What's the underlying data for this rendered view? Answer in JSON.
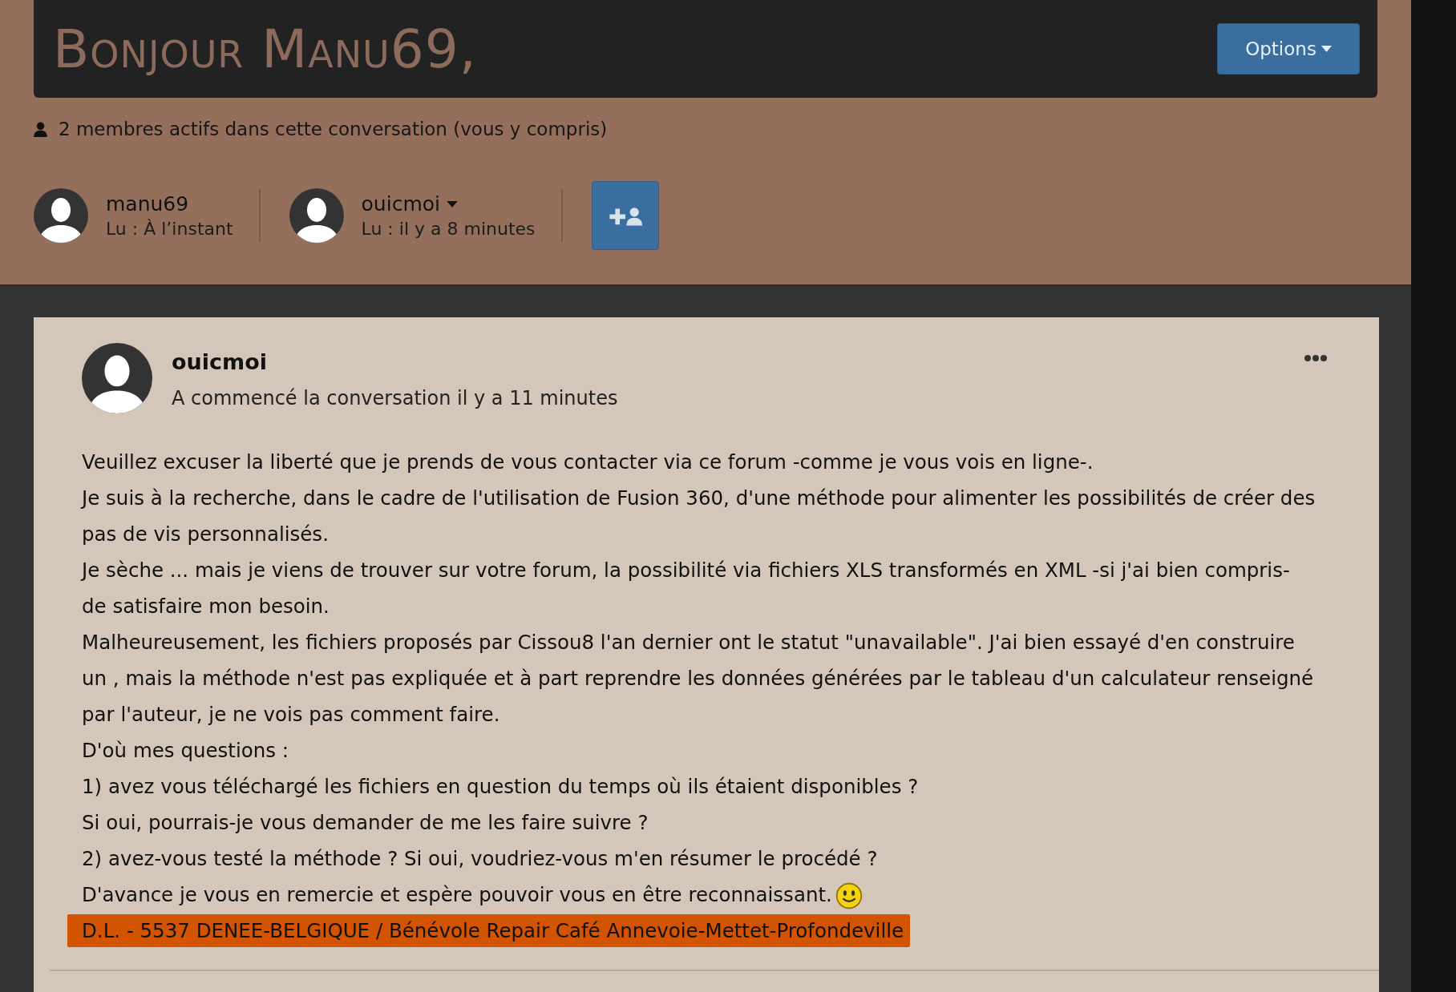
{
  "header": {
    "title": "Bonjour Manu69,",
    "options_button": "Options"
  },
  "members_summary": "2 membres actifs dans cette conversation (vous y compris)",
  "participants": [
    {
      "name": "manu69",
      "read": "Lu : À l’instant",
      "menu": false
    },
    {
      "name": "ouicmoi",
      "read": "Lu : il y a 8 minutes",
      "menu": true
    }
  ],
  "post": {
    "author": "ouicmoi",
    "meta": "A commencé la conversation il y a 11 minutes",
    "paragraphs": [
      {
        "text": "Veuillez excuser la liberté que je prends de vous contacter via ce forum -comme je vous vois en ligne-.",
        "smiley": false
      },
      {
        "text": "Je suis à la recherche, dans le cadre de l'utilisation de Fusion 360, d'une méthode pour alimenter les possibilités de créer des pas de vis personnalisés.",
        "smiley": false
      },
      {
        "text": "Je sèche ... mais je viens de trouver sur votre forum, la possibilité via fichiers XLS transformés en XML -si j'ai bien compris- de satisfaire mon besoin.",
        "smiley": false
      },
      {
        "text": "Malheureusement, les fichiers proposés par Cissou8 l'an dernier ont le statut \"unavailable\". J'ai bien essayé d'en construire un , mais la méthode n'est pas expliquée et à part reprendre les données générées par le tableau d'un calculateur renseigné par l'auteur, je ne vois pas comment faire.",
        "smiley": false
      },
      {
        "text": "D'où mes questions :",
        "smiley": false
      },
      {
        "text": "1) avez vous téléchargé les fichiers en question du temps où ils étaient disponibles ?",
        "smiley": false
      },
      {
        "text": "Si oui, pourrais-je vous demander de me les faire suivre ?",
        "smiley": false
      },
      {
        "text": "2) avez-vous testé la méthode ? Si oui, voudriez-vous m'en résumer le procédé ?",
        "smiley": false
      },
      {
        "text": "D'avance je vous en remercie et espère pouvoir vous en être reconnaissant.",
        "smiley": true
      }
    ],
    "signature": "D.L. - 5537 DENEE-BELGIQUE / Bénévole Repair Café Annevoie-Mettet-Profondeville"
  }
}
